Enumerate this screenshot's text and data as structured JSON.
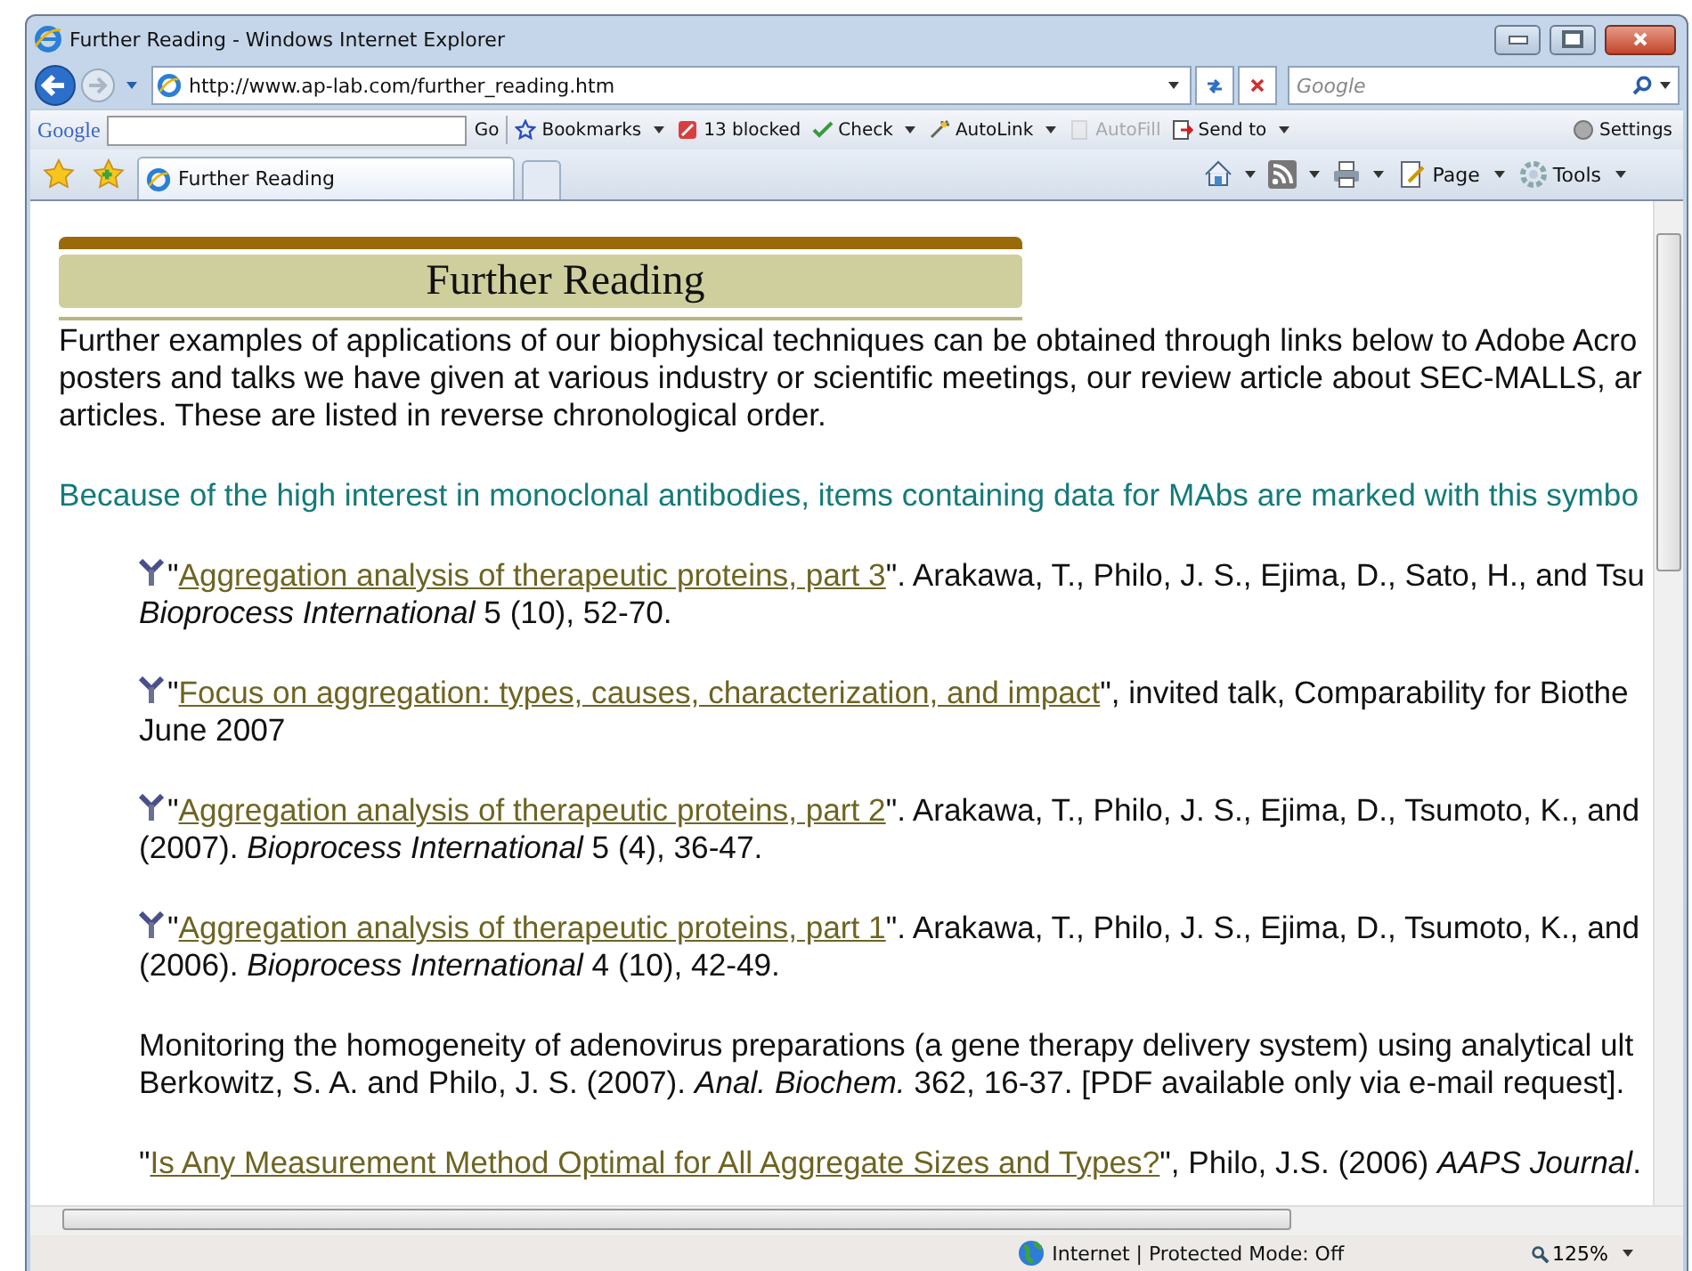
{
  "window": {
    "title": "Further Reading - Windows Internet Explorer"
  },
  "address_bar": {
    "url": "http://www.ap-lab.com/further_reading.htm"
  },
  "search": {
    "placeholder": "Google"
  },
  "google_toolbar": {
    "logo": "Google",
    "go": "Go",
    "items": [
      {
        "label": "Bookmarks",
        "caret": true,
        "disabled": false
      },
      {
        "label": "13 blocked",
        "caret": false,
        "disabled": false
      },
      {
        "label": "Check",
        "caret": true,
        "disabled": false
      },
      {
        "label": "AutoLink",
        "caret": true,
        "disabled": false
      },
      {
        "label": "AutoFill",
        "caret": false,
        "disabled": true
      },
      {
        "label": "Send to",
        "caret": true,
        "disabled": false
      }
    ],
    "settings": "Settings"
  },
  "tabs": [
    {
      "label": "Further Reading",
      "selected": true
    }
  ],
  "command_bar": [
    "Page",
    "Tools"
  ],
  "page": {
    "heading": "Further Reading",
    "intro": [
      "Further examples of applications of our biophysical techniques can be obtained through links below to Adobe Acro",
      "posters and talks we have given at various industry or scientific meetings, our review article about SEC-MALLS, ar",
      "articles. These are listed in reverse chronological order."
    ],
    "mab_note": "Because of the high interest in monoclonal antibodies, items containing data for MAbs are marked with this symbo",
    "references": [
      {
        "mab": true,
        "kind": "link",
        "before": "\"",
        "link": "Aggregation analysis of therapeutic proteins, part 3",
        "after": "\". Arakawa, T., Philo, J. S., Ejima, D., Sato, H., and Tsu",
        "line2": "*Bioprocess International* 5 (10), 52-70."
      },
      {
        "mab": true,
        "kind": "link",
        "before": "\"",
        "link": "Focus on aggregation: types, causes, characterization, and impact",
        "after": "\", invited talk, Comparability for Biothe",
        "line2": "June 2007"
      },
      {
        "mab": true,
        "kind": "link",
        "before": "\"",
        "link": "Aggregation analysis of therapeutic proteins, part 2",
        "after": "\". Arakawa, T., Philo, J. S., Ejima, D., Tsumoto, K., and",
        "line2": "(2007). *Bioprocess International* 5 (4), 36-47."
      },
      {
        "mab": true,
        "kind": "link",
        "before": "\"",
        "link": "Aggregation analysis of therapeutic proteins, part 1",
        "after": "\". Arakawa, T., Philo, J. S., Ejima, D., Tsumoto, K., and",
        "line2": "(2006). *Bioprocess International* 4 (10), 42-49."
      },
      {
        "mab": false,
        "kind": "plain",
        "line1": "Monitoring the homogeneity of adenovirus preparations (a gene therapy delivery system) using analytical ult",
        "line2": "Berkowitz, S. A. and Philo, J. S. (2007). *Anal. Biochem.* 362, 16-37. [PDF available only via e-mail request]."
      },
      {
        "mab": false,
        "kind": "link",
        "before": "\"",
        "link": "Is Any Measurement Method Optimal for All Aggregate Sizes and Types?",
        "after": "\", Philo, J.S. (2006) *AAPS Journal*."
      }
    ]
  },
  "status_bar": {
    "zone": "Internet | Protected Mode: Off",
    "zoom": "125%"
  }
}
